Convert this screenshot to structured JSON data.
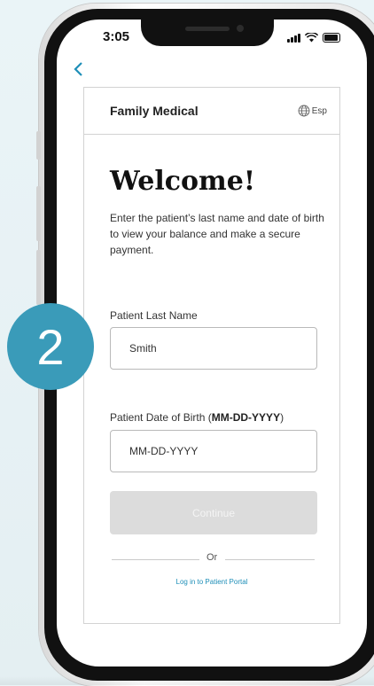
{
  "status_bar": {
    "time": "3:05"
  },
  "header": {
    "brand": "Family Medical",
    "language_toggle": "Esp"
  },
  "main": {
    "title": "Welcome!",
    "intro": "Enter the patient’s last name and date of birth to view your balance and make a secure payment.",
    "last_name": {
      "label": "Patient Last Name",
      "value": "Smith"
    },
    "dob": {
      "label_prefix": "Patient Date of Birth (",
      "label_format": "MM-DD-YYYY",
      "label_suffix": ")",
      "placeholder": "MM-DD-YYYY"
    },
    "continue_label": "Continue",
    "or_label": "Or",
    "portal_link": "Log in to Patient Portal"
  },
  "step_badge": "2",
  "colors": {
    "accent": "#1f8fb8",
    "step": "#3a9bb9",
    "button_disabled": "#dcdcdc"
  }
}
